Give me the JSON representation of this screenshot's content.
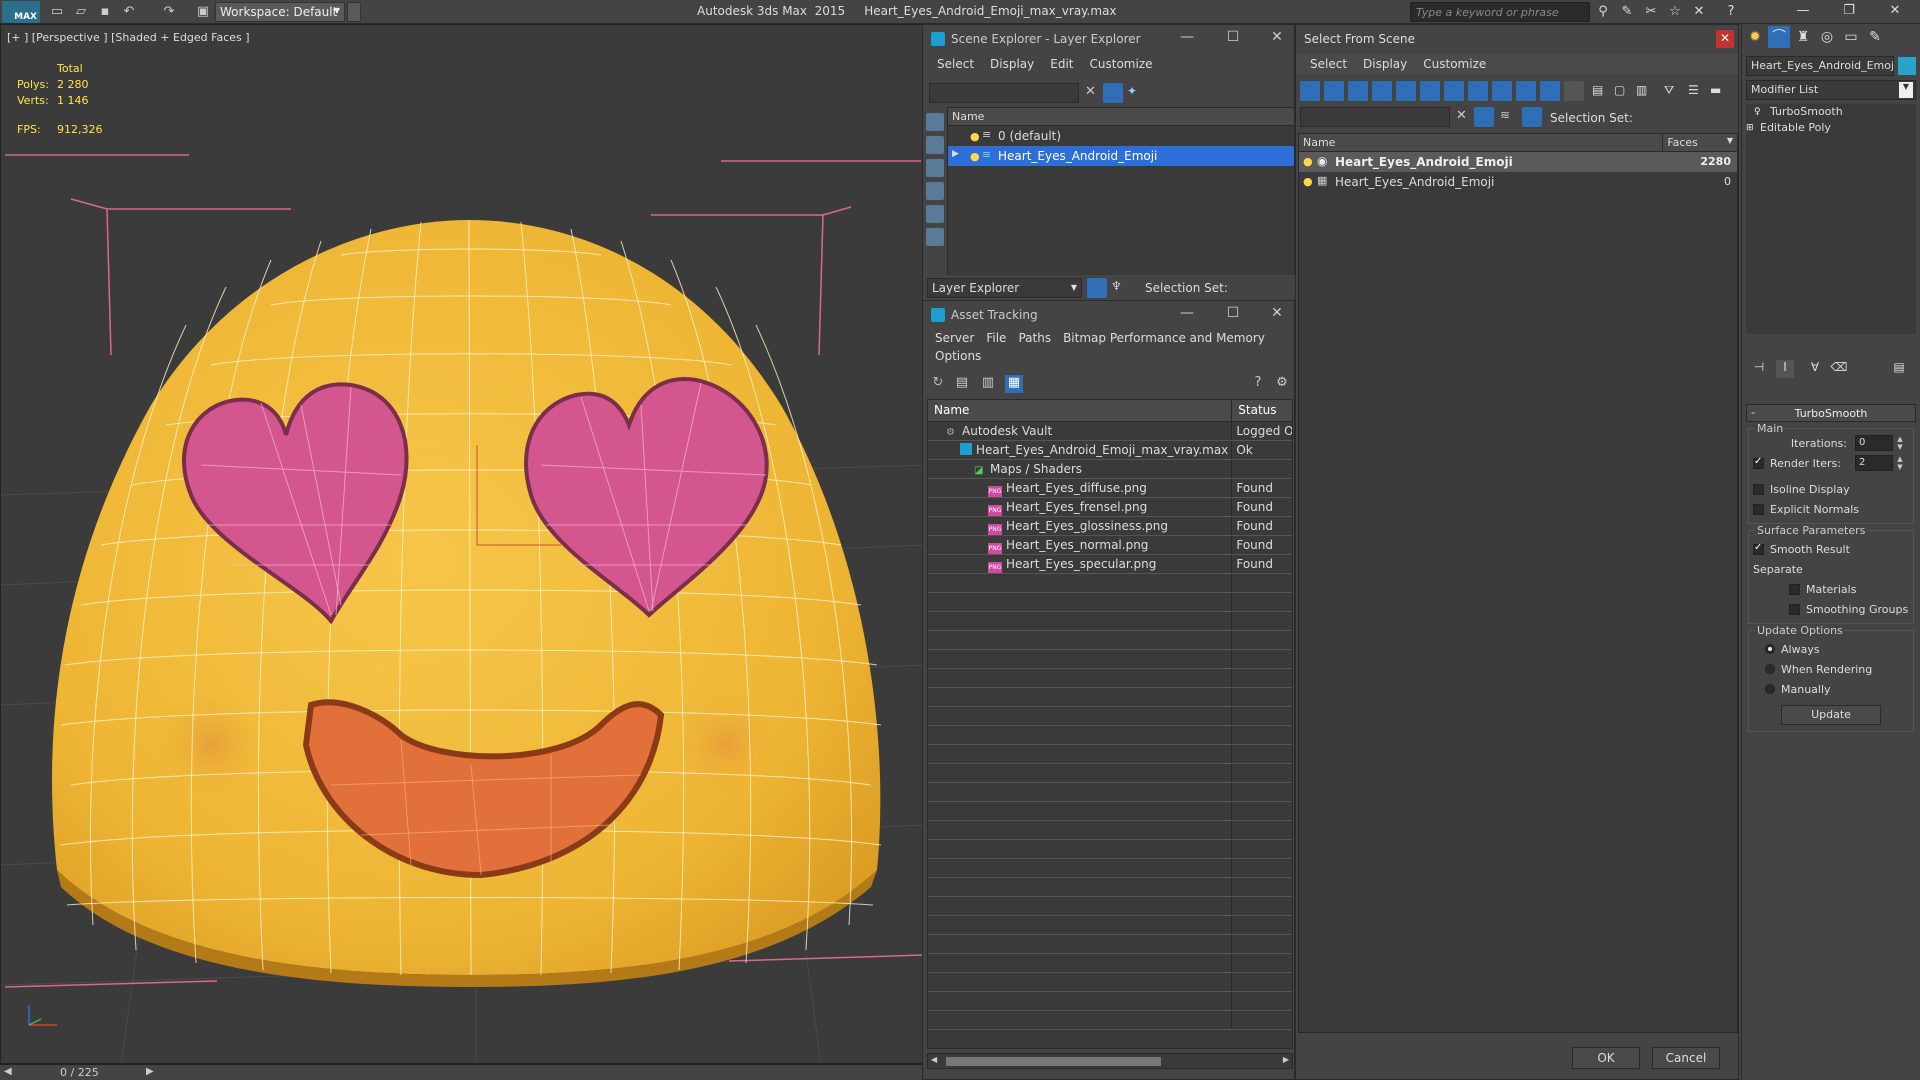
{
  "titlebar": {
    "logo": "MAX",
    "workspace": "Workspace: Default",
    "app_title": "Autodesk 3ds Max  2015     Heart_Eyes_Android_Emoji_max_vray.max",
    "search_placeholder": "Type a keyword or phrase"
  },
  "viewport": {
    "label": "[+ ] [Perspective ] [Shaded + Edged Faces ]",
    "stats": {
      "total_label": "Total",
      "polys_label": "Polys:",
      "polys_value": "2 280",
      "verts_label": "Verts:",
      "verts_value": "1 146",
      "fps_label": "FPS:",
      "fps_value": "912,326"
    },
    "time_counter": "0 / 225"
  },
  "scene_explorer": {
    "title": "Scene Explorer - Layer Explorer",
    "menu": [
      "Select",
      "Display",
      "Edit",
      "Customize"
    ],
    "column_name": "Name",
    "rows": [
      {
        "label": "0 (default)",
        "selected": false
      },
      {
        "label": "Heart_Eyes_Android_Emoji",
        "selected": true
      }
    ],
    "layer_dropdown": "Layer Explorer",
    "selection_set": "Selection Set:"
  },
  "asset_tracking": {
    "title": "Asset Tracking",
    "menu1": [
      "Server",
      "File",
      "Paths",
      "Bitmap Performance and Memory"
    ],
    "menu2": [
      "Options"
    ],
    "col_name": "Name",
    "col_status": "Status",
    "rows": [
      {
        "name": "Autodesk Vault",
        "status": "Logged Out",
        "indent": 1,
        "icon": "vault"
      },
      {
        "name": "Heart_Eyes_Android_Emoji_max_vray.max",
        "status": "Ok",
        "indent": 2,
        "icon": "max"
      },
      {
        "name": "Maps / Shaders",
        "status": "",
        "indent": 3,
        "icon": "maps"
      },
      {
        "name": "Heart_Eyes_diffuse.png",
        "status": "Found",
        "indent": 4,
        "icon": "png"
      },
      {
        "name": "Heart_Eyes_frensel.png",
        "status": "Found",
        "indent": 4,
        "icon": "png"
      },
      {
        "name": "Heart_Eyes_glossiness.png",
        "status": "Found",
        "indent": 4,
        "icon": "png"
      },
      {
        "name": "Heart_Eyes_normal.png",
        "status": "Found",
        "indent": 4,
        "icon": "png"
      },
      {
        "name": "Heart_Eyes_specular.png",
        "status": "Found",
        "indent": 4,
        "icon": "png"
      }
    ],
    "png_badge": "PNG"
  },
  "select_from_scene": {
    "title": "Select From Scene",
    "menu": [
      "Select",
      "Display",
      "Customize"
    ],
    "selection_set": "Selection Set:",
    "col_name": "Name",
    "col_faces": "Faces",
    "rows": [
      {
        "name": "Heart_Eyes_Android_Emoji",
        "faces": "2280",
        "highlight": true
      },
      {
        "name": "Heart_Eyes_Android_Emoji",
        "faces": "0",
        "highlight": false
      }
    ],
    "ok": "OK",
    "cancel": "Cancel"
  },
  "command_panel": {
    "object_name": "Heart_Eyes_Android_Emoji",
    "modifier_list": "Modifier List",
    "stack": [
      "TurboSmooth",
      "Editable Poly"
    ],
    "rollout_title": "TurboSmooth",
    "main_group": "Main",
    "iterations_label": "Iterations:",
    "iterations_value": "0",
    "render_iters_label": "Render Iters:",
    "render_iters_value": "2",
    "isoline": "Isoline Display",
    "explicit_normals": "Explicit Normals",
    "surface_group": "Surface Parameters",
    "smooth_result": "Smooth Result",
    "separate_label": "Separate",
    "materials": "Materials",
    "smoothing_groups": "Smoothing Groups",
    "update_group": "Update Options",
    "always": "Always",
    "when_rendering": "When Rendering",
    "manually": "Manually",
    "update_btn": "Update"
  },
  "colors": {
    "emoji_yellow": "#f2bd3c",
    "heart_pink": "#d4568f",
    "mouth_orange": "#e2703a",
    "selection_blue": "#2d6fd6"
  }
}
